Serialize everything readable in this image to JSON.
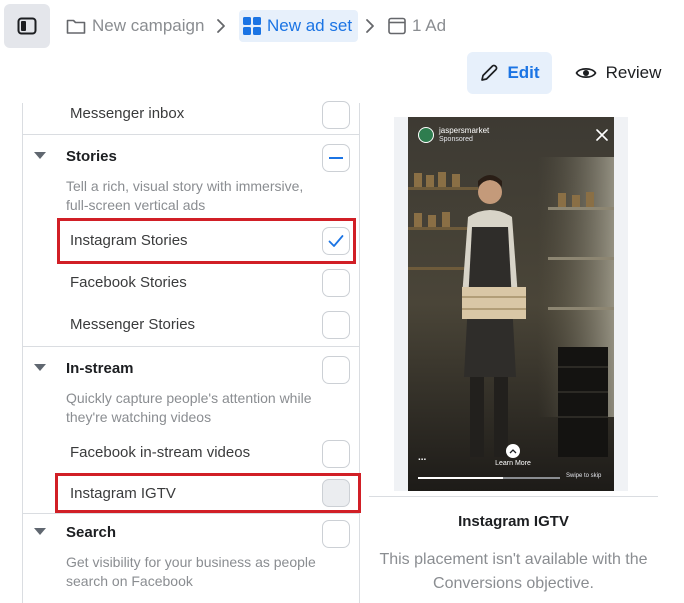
{
  "breadcrumb": {
    "campaign": "New campaign",
    "adset": "New ad set",
    "ad": "1 Ad"
  },
  "actions": {
    "edit": "Edit",
    "review": "Review"
  },
  "placements": {
    "messenger_inbox": "Messenger inbox",
    "stories": {
      "title": "Stories",
      "description": "Tell a rich, visual story with immersive, full-screen vertical ads",
      "items": [
        "Instagram Stories",
        "Facebook Stories",
        "Messenger Stories"
      ]
    },
    "instream": {
      "title": "In-stream",
      "description": "Quickly capture people's attention while they're watching videos",
      "items": [
        "Facebook in-stream videos",
        "Instagram IGTV"
      ]
    },
    "search": {
      "title": "Search",
      "description": "Get visibility for your business as people search on Facebook"
    }
  },
  "preview": {
    "account": "jaspersmarket",
    "sponsored": "Sponsored",
    "cta": "Learn More",
    "swipe": "Swipe to skip",
    "more": "...",
    "title": "Instagram IGTV",
    "note": "This placement isn't available with the Conversions objective."
  },
  "colors": {
    "accent": "#1b74e4",
    "highlight": "#d11f26"
  }
}
